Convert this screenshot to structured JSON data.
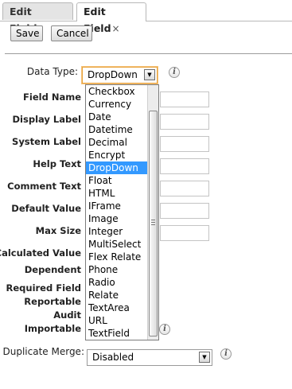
{
  "tabs": [
    {
      "label": "Edit Fields"
    },
    {
      "label": "Edit Field",
      "close_glyph": "×"
    }
  ],
  "toolbar": {
    "save_label": "Save",
    "cancel_label": "Cancel"
  },
  "form": {
    "data_type_label": "Data Type:",
    "data_type_value": "DropDown",
    "labels": {
      "field_name": "Field Name",
      "display_label": "Display Label",
      "system_label": "System Label",
      "help_text": "Help Text",
      "comment_text": "Comment Text",
      "default_value": "Default Value",
      "max_size": "Max Size",
      "calculated_value": "Calculated Value",
      "dependent": "Dependent",
      "required_field": "Required Field",
      "reportable": "Reportable",
      "audit": "Audit",
      "importable": "Importable"
    },
    "duplicate_merge_label": "Duplicate Merge:",
    "duplicate_merge_value": "Disabled",
    "info_glyph": "i"
  },
  "dropdown": {
    "options": [
      "Checkbox",
      "Currency",
      "Date",
      "Datetime",
      "Decimal",
      "Encrypt",
      "DropDown",
      "Float",
      "HTML",
      "IFrame",
      "Image",
      "Integer",
      "MultiSelect",
      "Flex Relate",
      "Phone",
      "Radio",
      "Relate",
      "TextArea",
      "URL",
      "TextField"
    ],
    "selected": "DropDown"
  },
  "icons": {
    "select_arrow": "chevron-down-icon",
    "info": "info-icon",
    "close": "close-icon"
  }
}
